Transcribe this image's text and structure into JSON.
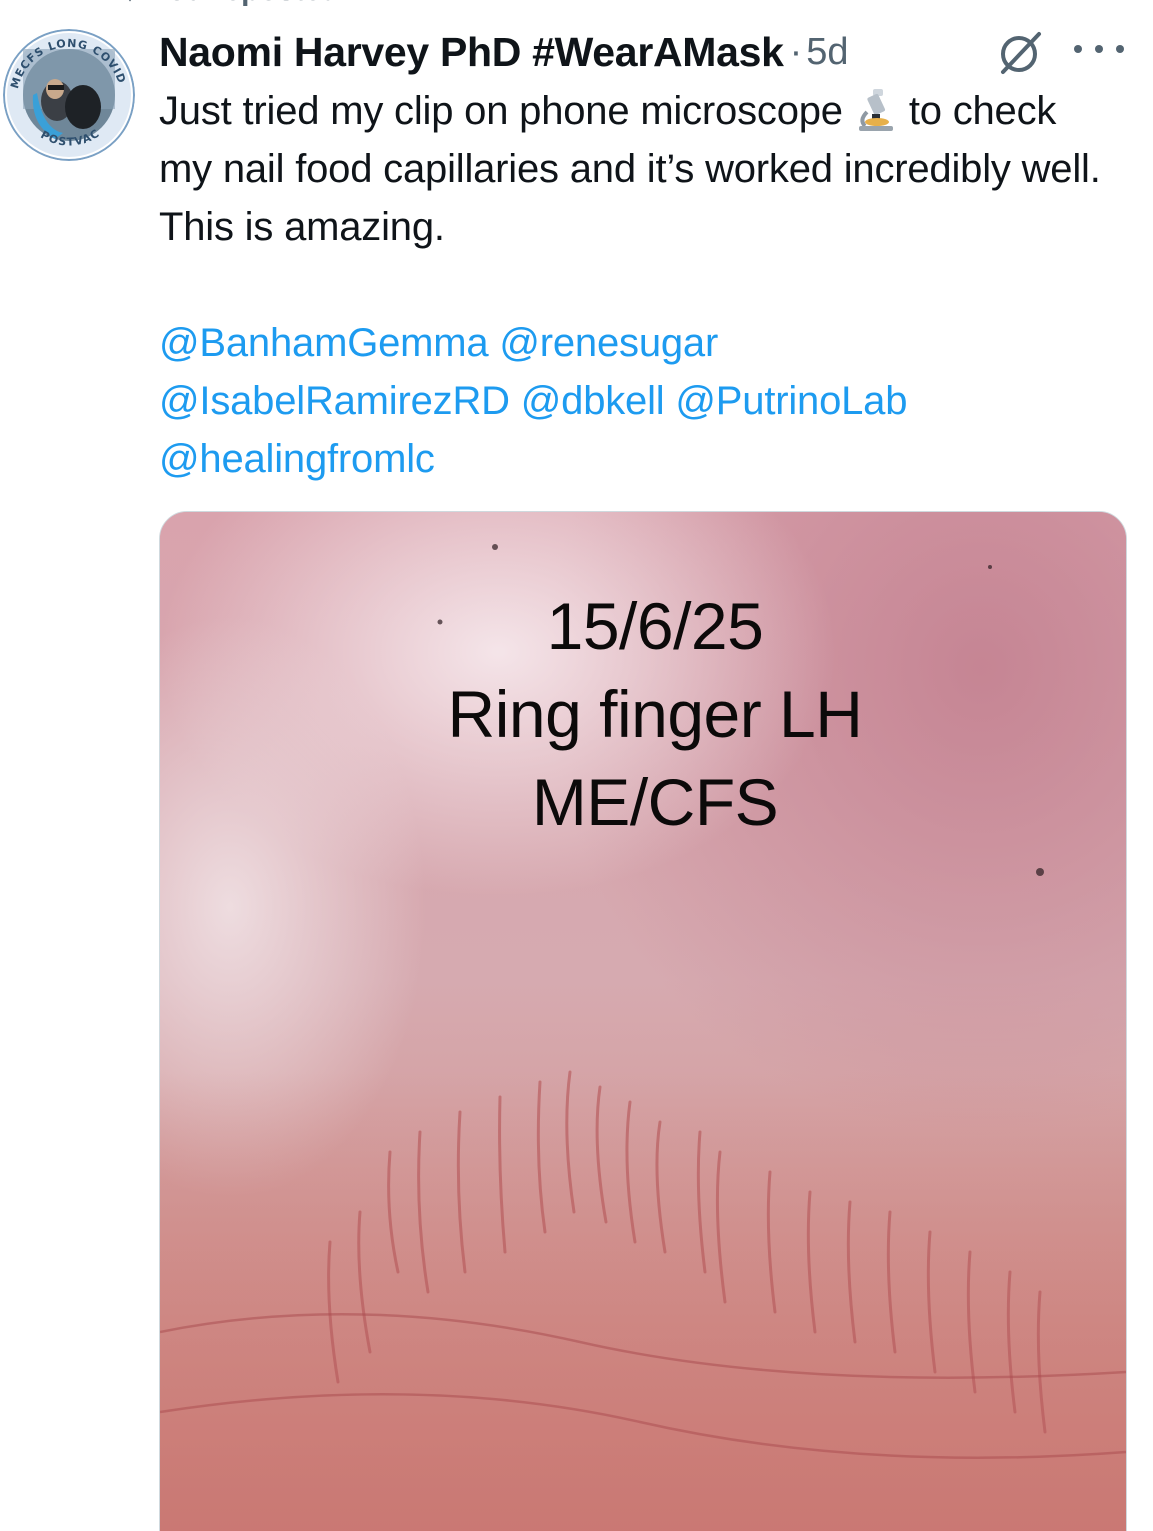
{
  "repost": {
    "label": "You reposted"
  },
  "tweet": {
    "author": {
      "display_name": "Naomi Harvey PhD #WearAMask",
      "avatar_ring_text_top": "MECFS LONG COVID",
      "avatar_ring_text_bottom": "POSTVAC"
    },
    "separator": "·",
    "timestamp": "5d",
    "text_before_emoji": "Just tried my clip on phone microscope",
    "emoji": "microscope-emoji",
    "text_after_emoji": "to check my nail food capillaries and it’s worked incredibly well. This is amazing.",
    "mentions": [
      "@BanhamGemma",
      "@renesugar",
      "@IsabelRamirezRD",
      "@dbkell",
      "@PutrinoLab",
      "@healingfromlc"
    ],
    "media": {
      "caption_line1": "15/6/25",
      "caption_line2": "Ring finger LH",
      "caption_line3": "ME/CFS"
    }
  },
  "icons": {
    "repost": "repost-icon",
    "grok": "grok-icon",
    "more": "more-icon"
  },
  "colors": {
    "link": "#1d9bf0",
    "secondary_text": "#536471",
    "primary_text": "#0f1419"
  }
}
